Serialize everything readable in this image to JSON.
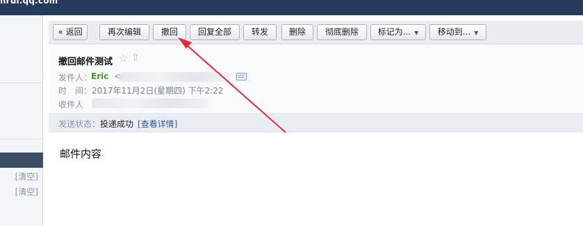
{
  "topbar": {
    "host": "lirui.qq.com"
  },
  "sidebar": {
    "clear_labels": [
      "[清空]",
      "[清空]"
    ]
  },
  "toolbar": {
    "back": "« 返回",
    "reedit": "再次编辑",
    "recall": "撤回",
    "reply_all": "回复全部",
    "forward": "转发",
    "delete": "删除",
    "delete_permanently": "彻底删除",
    "mark_as": "标记为...",
    "move_to": "移动到..."
  },
  "mail": {
    "subject": "撤回邮件测试",
    "sender_label": "发件人：",
    "sender_name": "Eric",
    "sender_bracket": "<",
    "time_label": "时　间：",
    "time_value": "2017年11月2日(星期四) 下午2:22",
    "recipient_label": "收件人",
    "status_label": "发送状态：",
    "status_value": "投递成功",
    "status_link": "[查看详情]",
    "body": "邮件内容"
  },
  "colors": {
    "annotation_arrow": "#e8283a",
    "sender_name": "#4c9a22",
    "link": "#2b5aa8"
  }
}
